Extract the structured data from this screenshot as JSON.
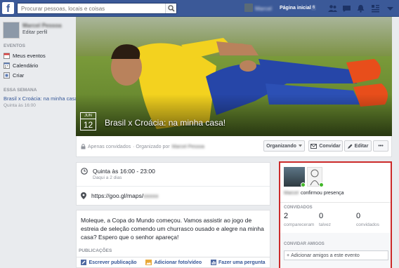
{
  "topbar": {
    "logo": "f",
    "search_placeholder": "Procurar pessoas, locais e coisas",
    "user_name": "Marcel",
    "home_label": "Página inicial",
    "home_count": "6",
    "icons": [
      "friend-requests-icon",
      "messages-icon",
      "notifications-icon",
      "privacy-icon",
      "settings-icon"
    ]
  },
  "sidebar": {
    "profile_name": "Marcel Pessoa",
    "edit_profile": "Editar perfil",
    "events_header": "EVENTOS",
    "items": [
      {
        "label": "Meus eventos",
        "icon": "calendar-icon"
      },
      {
        "label": "Calendário",
        "icon": "calendar-grid-icon"
      },
      {
        "label": "Criar",
        "icon": "create-icon"
      }
    ],
    "week_header": "ESSA SEMANA",
    "week_event": "Brasil x Croácia: na minha casa!",
    "week_time": "Quinta às 16:00"
  },
  "event": {
    "month": "JUN",
    "day": "12",
    "title": "Brasil x Croácia: na minha casa!",
    "privacy": "Apenas convidados",
    "organized_by_label": "· Organizado por",
    "organizer": "Marcel Pessoa",
    "buttons": {
      "organizing": "Organizando",
      "invite": "Convidar",
      "edit": "Editar",
      "more": "•••"
    },
    "time_main": "Quinta às 16:00 - 23:00",
    "time_sub": "Daqui a 2 dias",
    "map_url": "https://goo.gl/maps/",
    "map_hidden": "xxxxx",
    "description": "Moleque, a Copa do Mundo começou. Vamos assistir ao jogo de estreia de seleção comendo um churrasco ousado e alegre na minha casa? Espero que o senhor apareça!",
    "publications_label": "PUBLICAÇÕES",
    "composer": {
      "write": "Escrever publicação",
      "photo": "Adicionar foto/vídeo",
      "question": "Fazer uma pergunta"
    }
  },
  "widget": {
    "confirmed_name": "Marcel",
    "confirmed_text": "confirmou presença",
    "invited_header": "CONVIDADOS",
    "stats": [
      {
        "value": "2",
        "label": "compareceram"
      },
      {
        "value": "0",
        "label": "talvez"
      },
      {
        "value": "0",
        "label": "convidados"
      }
    ],
    "invite_header": "CONVIDAR AMIGOS",
    "invite_placeholder": "Adicionar amigos a este evento"
  },
  "colors": {
    "brand": "#3b5998",
    "highlight_border": "#cc2a2a",
    "going": "#42b72a"
  }
}
